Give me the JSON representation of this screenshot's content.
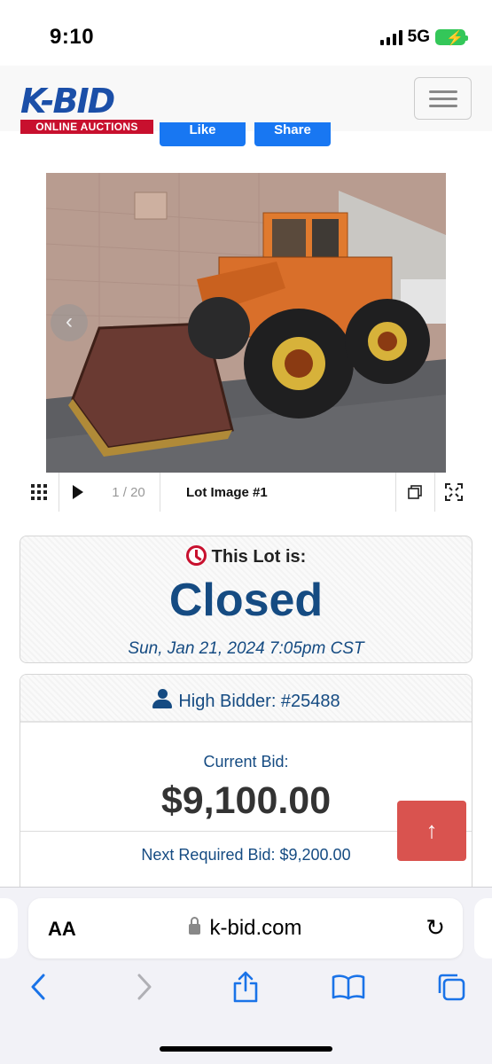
{
  "status_bar": {
    "time": "9:10",
    "network": "5G"
  },
  "header": {
    "logo_main": "K-BID",
    "logo_sub": "ONLINE AUCTIONS",
    "like_label": "Like",
    "share_label": "Share",
    "menu_icon": "hamburger-icon"
  },
  "gallery": {
    "counter": "1 / 20",
    "image_title": "Lot Image #1"
  },
  "lot_status": {
    "label": "This Lot is:",
    "state": "Closed",
    "closed_at": "Sun, Jan 21, 2024 7:05pm CST"
  },
  "bidding": {
    "high_bidder": "High Bidder: #25488",
    "current_bid_label": "Current Bid:",
    "current_bid": "$9,100.00",
    "next_required": "Next Required Bid: $9,200.00"
  },
  "browser": {
    "text_size": "AA",
    "url": "k-bid.com"
  },
  "colors": {
    "brand_blue": "#154b82",
    "brand_red": "#c8102e",
    "scroll_top_button": "#d9534f",
    "facebook": "#1877f2"
  }
}
